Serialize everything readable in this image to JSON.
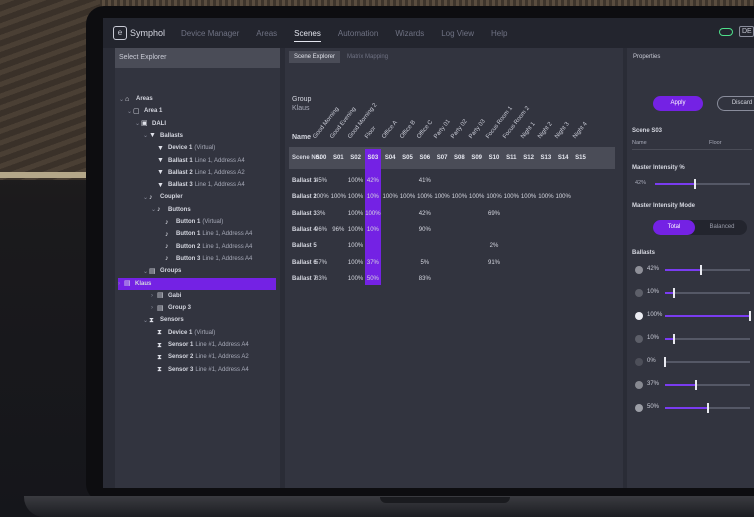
{
  "app": {
    "name": "Symphol",
    "lang": "DE"
  },
  "nav": [
    "Device Manager",
    "Areas",
    "Scenes",
    "Automation",
    "Wizards",
    "Log View",
    "Help"
  ],
  "nav_active": 2,
  "left_panel": {
    "title": "Select Explorer",
    "tree": [
      {
        "level": 0,
        "chev": "⌄",
        "icon": "home",
        "bold": "Areas",
        "rest": ""
      },
      {
        "level": 1,
        "chev": "⌄",
        "icon": "area",
        "bold": "Area 1",
        "rest": ""
      },
      {
        "level": 2,
        "chev": "⌄",
        "icon": "dali",
        "bold": "DALI",
        "rest": ""
      },
      {
        "level": 3,
        "chev": "⌄",
        "icon": "ballast",
        "bold": "Ballasts",
        "rest": ""
      },
      {
        "level": 4,
        "chev": "",
        "icon": "ballast",
        "bold": "Device 1",
        "rest": "(Virtual)"
      },
      {
        "level": 4,
        "chev": "",
        "icon": "ballast",
        "bold": "Ballast 1",
        "rest": "Line 1, Address A4"
      },
      {
        "level": 4,
        "chev": "",
        "icon": "ballast",
        "bold": "Ballast 2",
        "rest": "Line 1, Address A2"
      },
      {
        "level": 4,
        "chev": "",
        "icon": "ballast",
        "bold": "Ballast 3",
        "rest": "Line 1, Address A4"
      },
      {
        "level": 3,
        "chev": "⌄",
        "icon": "coupler",
        "bold": "Coupler",
        "rest": ""
      },
      {
        "level": 4,
        "chev": "⌄",
        "icon": "button",
        "bold": "Buttons",
        "rest": ""
      },
      {
        "level": 5,
        "chev": "",
        "icon": "button",
        "bold": "Button 1",
        "rest": "(Virtual)"
      },
      {
        "level": 5,
        "chev": "",
        "icon": "button",
        "bold": "Button 1",
        "rest": "Line 1, Address A4"
      },
      {
        "level": 5,
        "chev": "",
        "icon": "button",
        "bold": "Button 2",
        "rest": "Line 1, Address A4"
      },
      {
        "level": 5,
        "chev": "",
        "icon": "button",
        "bold": "Button 3",
        "rest": "Line 1, Address A4"
      },
      {
        "level": 3,
        "chev": "⌄",
        "icon": "group",
        "bold": "Groups",
        "rest": ""
      },
      {
        "level": 4,
        "chev": "›",
        "icon": "group",
        "bold": "Klaus",
        "rest": "",
        "selected": true
      },
      {
        "level": 4,
        "chev": "›",
        "icon": "group",
        "bold": "Gabi",
        "rest": ""
      },
      {
        "level": 4,
        "chev": "›",
        "icon": "group",
        "bold": "Group 3",
        "rest": ""
      },
      {
        "level": 3,
        "chev": "⌄",
        "icon": "sensor",
        "bold": "Sensors",
        "rest": ""
      },
      {
        "level": 4,
        "chev": "",
        "icon": "sensor",
        "bold": "Device 1",
        "rest": "(Virtual)"
      },
      {
        "level": 4,
        "chev": "",
        "icon": "sensor",
        "bold": "Sensor 1",
        "rest": "Line #1, Address A4"
      },
      {
        "level": 4,
        "chev": "",
        "icon": "sensor",
        "bold": "Sensor 2",
        "rest": "Line #1, Address A2"
      },
      {
        "level": 4,
        "chev": "",
        "icon": "sensor",
        "bold": "Sensor 3",
        "rest": "Line #1, Address A4"
      }
    ]
  },
  "center": {
    "tabs": [
      "Scene Explorer",
      "Matrix Mapping"
    ],
    "group_label": "Group",
    "group_value": "Klaus",
    "name_label": "Name",
    "scene_no_label": "Scene No.",
    "scene_names": [
      "Good Morning",
      "Good Evening",
      "Good Morning 2",
      "Floor",
      "Office A",
      "Office B",
      "Office C",
      "Party 01",
      "Party 02",
      "Party 03",
      "Focus Room 1",
      "Focus Room 2",
      "Night 1",
      "Night 2",
      "Night 3",
      "Night 4"
    ],
    "scenes": [
      "S00",
      "S01",
      "S02",
      "S03",
      "S04",
      "S05",
      "S06",
      "S07",
      "S08",
      "S09",
      "S10",
      "S11",
      "S12",
      "S13",
      "S14",
      "S15"
    ],
    "selected_scene": 3,
    "rows": [
      {
        "name": "Ballast 1",
        "values": [
          "45%",
          "",
          "100%",
          "42%",
          "",
          "",
          "41%",
          "",
          "",
          "",
          "",
          "",
          "",
          "",
          "",
          ""
        ]
      },
      {
        "name": "Ballast 2",
        "values": [
          "100%",
          "100%",
          "100%",
          "10%",
          "100%",
          "100%",
          "100%",
          "100%",
          "100%",
          "100%",
          "100%",
          "100%",
          "100%",
          "100%",
          "100%",
          ""
        ]
      },
      {
        "name": "Ballast 3",
        "values": [
          "3%",
          "",
          "100%",
          "100%",
          "",
          "",
          "42%",
          "",
          "",
          "",
          "69%",
          "",
          "",
          "",
          "",
          ""
        ]
      },
      {
        "name": "Ballast 4",
        "values": [
          "96%",
          "96%",
          "100%",
          "10%",
          "",
          "",
          "90%",
          "",
          "",
          "",
          "",
          "",
          "",
          "",
          "",
          ""
        ]
      },
      {
        "name": "Ballast 5",
        "values": [
          "",
          "",
          "100%",
          "",
          "",
          "",
          "",
          "",
          "",
          "",
          "2%",
          "",
          "",
          "",
          "",
          ""
        ]
      },
      {
        "name": "Ballast 6",
        "values": [
          "57%",
          "",
          "100%",
          "37%",
          "",
          "",
          "5%",
          "",
          "",
          "",
          "91%",
          "",
          "",
          "",
          "",
          ""
        ]
      },
      {
        "name": "Ballast 7",
        "values": [
          "83%",
          "",
          "100%",
          "50%",
          "",
          "",
          "83%",
          "",
          "",
          "",
          "",
          "",
          "",
          "",
          "",
          ""
        ]
      }
    ]
  },
  "properties": {
    "title": "Properties",
    "apply": "Apply",
    "discard": "Discard",
    "scene_title": "Scene S03",
    "name_label": "Name",
    "name_value": "Floor",
    "master_intensity_label": "Master Intensity %",
    "master_intensity": "42%",
    "master_intensity_value": 42,
    "mode_label": "Master Intensity Mode",
    "mode_total": "Total",
    "mode_balanced": "Balanced",
    "ballasts_label": "Ballasts",
    "ballasts": [
      {
        "value": "42%",
        "level": 42
      },
      {
        "value": "10%",
        "level": 10
      },
      {
        "value": "100%",
        "level": 100
      },
      {
        "value": "10%",
        "level": 10
      },
      {
        "value": "0%",
        "level": 0
      },
      {
        "value": "37%",
        "level": 37
      },
      {
        "value": "50%",
        "level": 50
      }
    ]
  }
}
